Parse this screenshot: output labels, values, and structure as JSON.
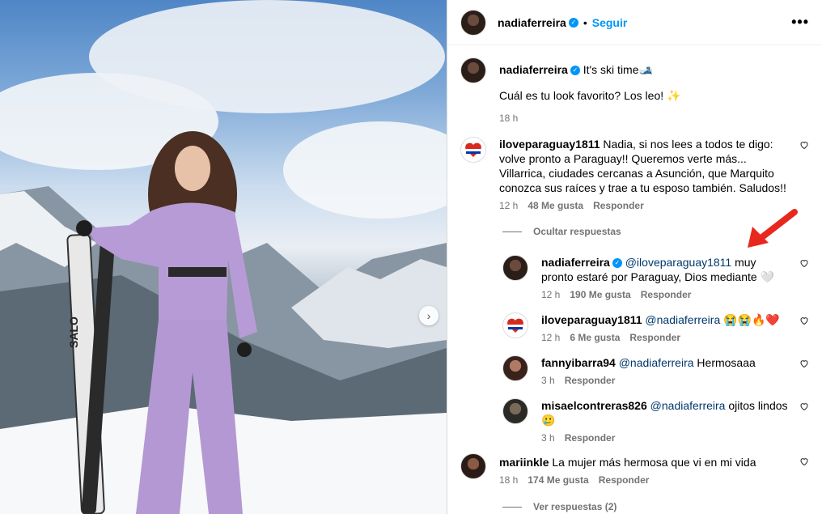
{
  "header": {
    "username": "nadiaferreira",
    "follow_label": "Seguir",
    "dot": "•",
    "more": "•••"
  },
  "caption": {
    "username": "nadiaferreira",
    "text1": "It's ski time🎿",
    "text2": "Cuál es tu look favorito? Los leo! ✨",
    "time": "18 h"
  },
  "comments": [
    {
      "username": "iloveparaguay1811",
      "text": "Nadia, si nos lees a todos te digo: volve pronto a Paraguay!! Queremos verte más... Villarrica, ciudades cercanas a Asunción, que Marquito conozca sus raíces y trae a tu esposo también. Saludos!!",
      "time": "12 h",
      "likes": "48 Me gusta",
      "reply": "Responder"
    },
    {
      "username": "mariinkle",
      "text": "La mujer más hermosa que vi en mi vida",
      "time": "18 h",
      "likes": "174 Me gusta",
      "reply": "Responder"
    }
  ],
  "hide_replies": "Ocultar respuestas",
  "view_replies": "Ver respuestas (2)",
  "replies": [
    {
      "username": "nadiaferreira",
      "mention": "@iloveparaguay1811",
      "text": " muy pronto estaré por Paraguay, Dios mediante 🤍",
      "time": "12 h",
      "likes": "190 Me gusta",
      "reply": "Responder"
    },
    {
      "username": "iloveparaguay1811",
      "mention": "@nadiaferreira",
      "text": " 😭😭🔥❤️",
      "time": "12 h",
      "likes": "6 Me gusta",
      "reply": "Responder"
    },
    {
      "username": "fannyibarra94",
      "mention": "@nadiaferreira",
      "text": " Hermosaaa",
      "time": "3 h",
      "reply": "Responder"
    },
    {
      "username": "misaelcontreras826",
      "mention": "@nadiaferreira",
      "text": " ojitos lindos 🥲",
      "time": "3 h",
      "reply": "Responder"
    }
  ],
  "photo": {
    "ski_brand": "SALO"
  },
  "colors": {
    "accent": "#0095f6",
    "mention": "#00376b",
    "arrow": "#e8281e",
    "suit": "#b79bd6"
  }
}
